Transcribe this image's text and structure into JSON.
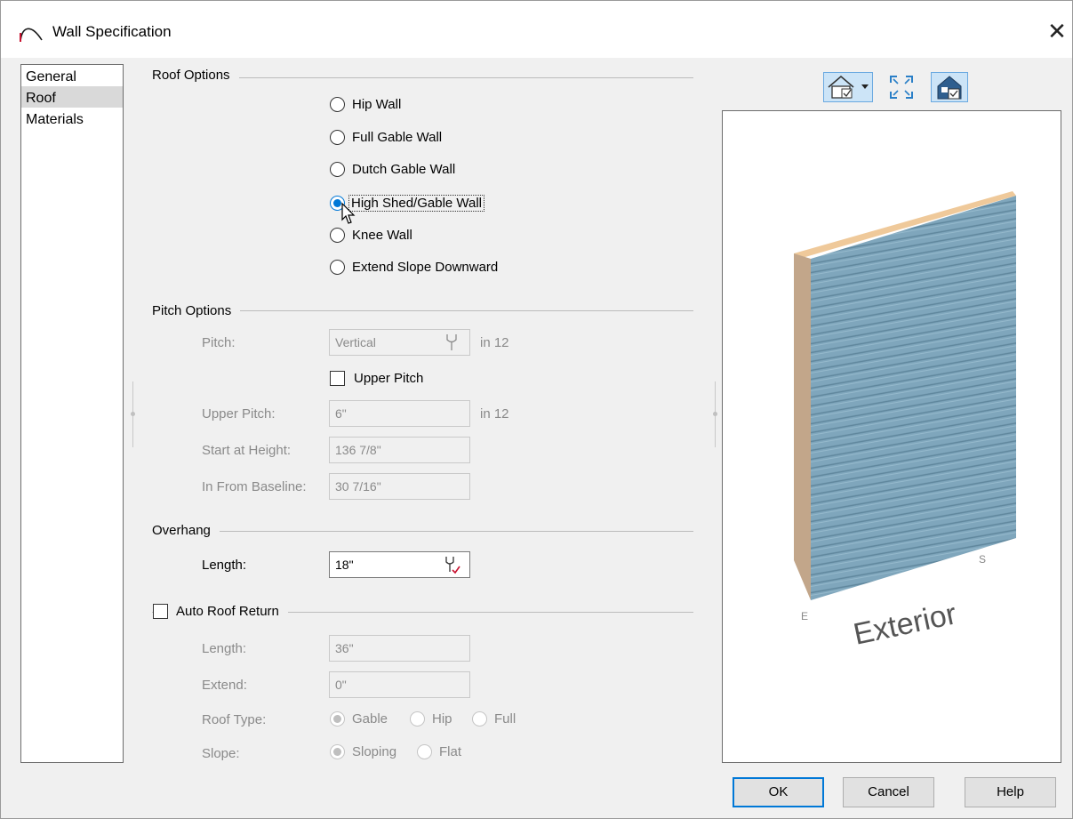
{
  "window": {
    "title": "Wall Specification",
    "close_glyph": "✕"
  },
  "sidebar": {
    "items": [
      {
        "label": "General",
        "selected": false
      },
      {
        "label": "Roof",
        "selected": true
      },
      {
        "label": "Materials",
        "selected": false
      }
    ]
  },
  "roof_options": {
    "header": "Roof Options",
    "options": [
      {
        "label": "Hip Wall",
        "checked": false
      },
      {
        "label": "Full Gable Wall",
        "checked": false
      },
      {
        "label": "Dutch Gable Wall",
        "checked": false
      },
      {
        "label": "High Shed/Gable Wall",
        "checked": true
      },
      {
        "label": "Knee Wall",
        "checked": false
      },
      {
        "label": "Extend Slope Downward",
        "checked": false
      }
    ]
  },
  "pitch_options": {
    "header": "Pitch Options",
    "pitch_label": "Pitch:",
    "pitch_value": "Vertical",
    "pitch_unit": "in 12",
    "upper_pitch_checkbox": "Upper Pitch",
    "upper_pitch_label": "Upper Pitch:",
    "upper_pitch_value": "6\"",
    "upper_pitch_unit": "in 12",
    "start_height_label": "Start at Height:",
    "start_height_value": "136 7/8\"",
    "baseline_label": "In From Baseline:",
    "baseline_value": "30 7/16\""
  },
  "overhang": {
    "header": "Overhang",
    "length_label": "Length:",
    "length_value": "18\""
  },
  "auto_roof_return": {
    "header": "Auto Roof Return",
    "length_label": "Length:",
    "length_value": "36\"",
    "extend_label": "Extend:",
    "extend_value": "0\"",
    "roof_type_label": "Roof Type:",
    "roof_type_options": [
      "Gable",
      "Hip",
      "Full"
    ],
    "slope_label": "Slope:",
    "slope_options": [
      "Sloping",
      "Flat"
    ]
  },
  "preview": {
    "label_exterior": "Exterior",
    "label_e": "E",
    "label_s": "S",
    "siding_color": "#7fa6bc",
    "edge_color": "#c2a68a",
    "top_color": "#efc99a"
  },
  "buttons": {
    "ok": "OK",
    "cancel": "Cancel",
    "help": "Help"
  },
  "colors": {
    "accent": "#0078d7"
  }
}
